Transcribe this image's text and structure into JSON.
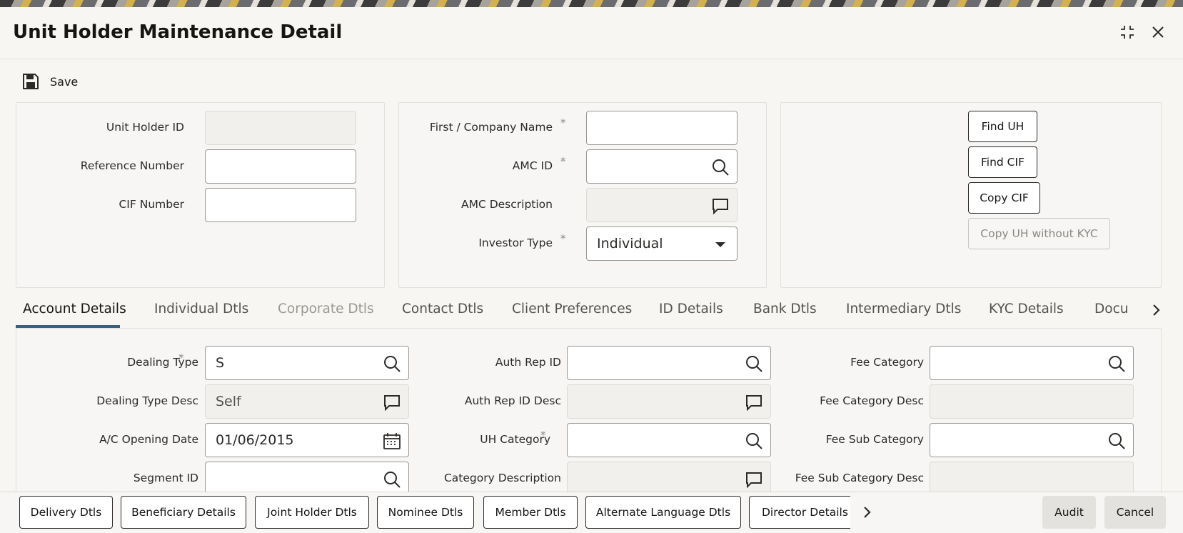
{
  "window": {
    "title": "Unit Holder Maintenance Detail",
    "maximize_icon": "collapse-icon",
    "close_icon": "close-icon"
  },
  "toolbar": {
    "save_label": "Save"
  },
  "header": {
    "left": {
      "unit_holder_id": {
        "label": "Unit Holder ID",
        "value": ""
      },
      "reference_number": {
        "label": "Reference Number",
        "value": ""
      },
      "cif_number": {
        "label": "CIF Number",
        "value": ""
      }
    },
    "middle": {
      "first_company_name": {
        "label": "First / Company Name",
        "required": "*",
        "value": ""
      },
      "amc_id": {
        "label": "AMC ID",
        "required": "*",
        "value": ""
      },
      "amc_description": {
        "label": "AMC Description",
        "value": ""
      },
      "investor_type": {
        "label": "Investor Type",
        "required": "*",
        "value": "Individual"
      }
    },
    "right_buttons": {
      "find_uh": "Find UH",
      "find_cif": "Find CIF",
      "copy_cif": "Copy CIF",
      "copy_uh_without_kyc": "Copy UH without KYC"
    }
  },
  "tabs": [
    {
      "label": "Account Details"
    },
    {
      "label": "Individual Dtls"
    },
    {
      "label": "Corporate Dtls"
    },
    {
      "label": "Contact Dtls"
    },
    {
      "label": "Client Preferences"
    },
    {
      "label": "ID Details"
    },
    {
      "label": "Bank Dtls"
    },
    {
      "label": "Intermediary Dtls"
    },
    {
      "label": "KYC Details"
    },
    {
      "label": "Docu"
    }
  ],
  "account_details": {
    "col1": {
      "dealing_type": {
        "label": "Dealing Type",
        "required": "*",
        "value": "S"
      },
      "dealing_type_desc": {
        "label": "Dealing Type Desc",
        "value": "Self"
      },
      "ac_opening_date": {
        "label": "A/C Opening Date",
        "value": "01/06/2015"
      },
      "segment_id": {
        "label": "Segment ID",
        "value": ""
      }
    },
    "col2": {
      "auth_rep_id": {
        "label": "Auth Rep ID",
        "value": ""
      },
      "auth_rep_id_desc": {
        "label": "Auth Rep ID Desc",
        "value": ""
      },
      "uh_category": {
        "label": "UH Category",
        "required": "*",
        "value": ""
      },
      "category_description": {
        "label": "Category Description",
        "value": ""
      }
    },
    "col3": {
      "fee_category": {
        "label": "Fee Category",
        "value": ""
      },
      "fee_category_desc": {
        "label": "Fee Category Desc",
        "value": ""
      },
      "fee_sub_category": {
        "label": "Fee Sub Category",
        "value": ""
      },
      "fee_sub_category_desc": {
        "label": "Fee Sub Category Desc",
        "value": ""
      }
    }
  },
  "footer": {
    "buttons": [
      "Delivery Dtls",
      "Beneficiary Details",
      "Joint Holder Dtls",
      "Nominee Dtls",
      "Member Dtls",
      "Alternate Language Dtls",
      "Director Details"
    ],
    "audit": "Audit",
    "cancel": "Cancel"
  }
}
